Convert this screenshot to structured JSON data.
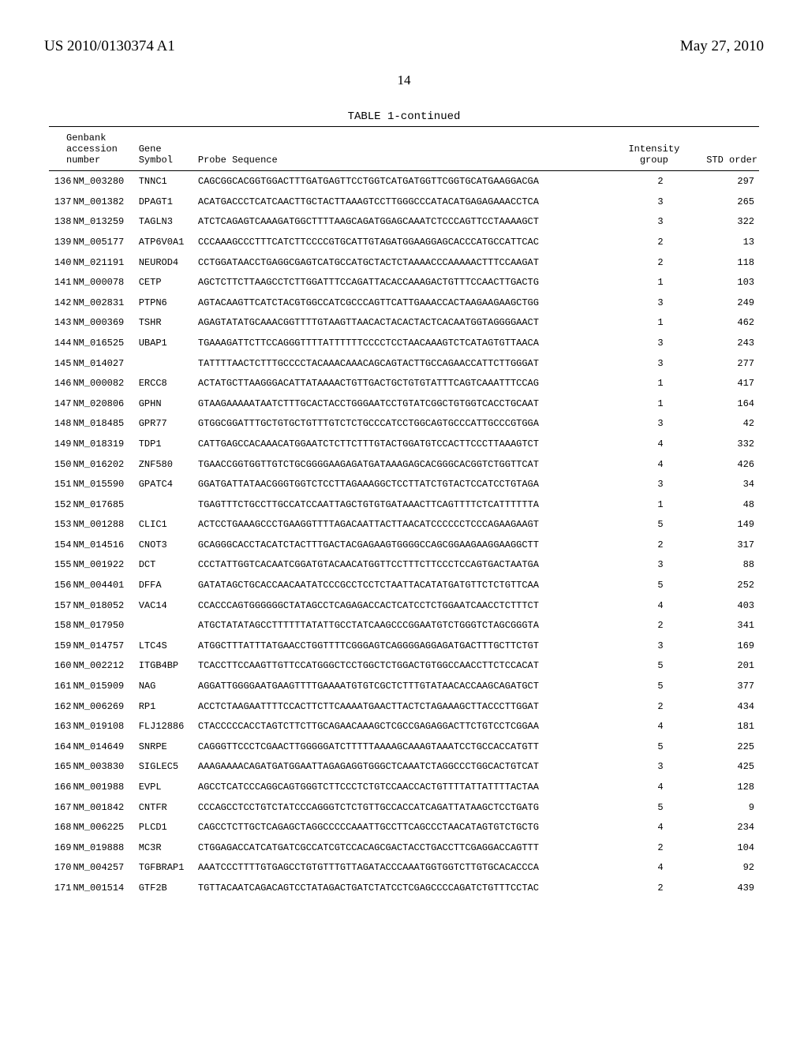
{
  "header": {
    "left": "US 2010/0130374 A1",
    "right": "May 27, 2010"
  },
  "page_number": "14",
  "table": {
    "caption": "TABLE 1-continued",
    "columns": {
      "genbank_l1": "Genbank",
      "genbank_l2": "accession",
      "genbank_l3": "number",
      "gene_l1": "Gene",
      "gene_l2": "Symbol",
      "probe": "Probe Sequence",
      "intensity_l1": "Intensity",
      "intensity_l2": "group",
      "std": "STD order"
    },
    "rows": [
      {
        "idx": "136",
        "acc": "NM_003280",
        "sym": "TNNC1",
        "seq": "CAGCGGCACGGTGGACTTTGATGAGTTCCTGGTCATGATGGTTCGGTGCATGAAGGACGA",
        "grp": "2",
        "std": "297"
      },
      {
        "idx": "137",
        "acc": "NM_001382",
        "sym": "DPAGT1",
        "seq": "ACATGACCCTCATCAACTTGCTACTTAAAGTCCTTGGGCCCATACATGAGAGAAACCTCA",
        "grp": "3",
        "std": "265"
      },
      {
        "idx": "138",
        "acc": "NM_013259",
        "sym": "TAGLN3",
        "seq": "ATCTCAGAGTCAAAGATGGCTTTTAAGCAGATGGAGCAAATCTCCCAGTTCCTAAAAGCT",
        "grp": "3",
        "std": "322"
      },
      {
        "idx": "139",
        "acc": "NM_005177",
        "sym": "ATP6V0A1",
        "seq": "CCCAAAGCCCTTTCATCTTCCCCGTGCATTGTAGATGGAAGGAGCACCCATGCCATTCAC",
        "grp": "2",
        "std": "13"
      },
      {
        "idx": "140",
        "acc": "NM_021191",
        "sym": "NEUROD4",
        "seq": "CCTGGATAACCTGAGGCGAGTCATGCCATGCTACTCTAAAACCCAAAAACTTTCCAAGAT",
        "grp": "2",
        "std": "118"
      },
      {
        "idx": "141",
        "acc": "NM_000078",
        "sym": "CETP",
        "seq": "AGCTCTTCTTAAGCCTCTTGGATTTCCAGATTACACCAAAGACTGTTTCCAACTTGACTG",
        "grp": "1",
        "std": "103"
      },
      {
        "idx": "142",
        "acc": "NM_002831",
        "sym": "PTPN6",
        "seq": "AGTACAAGTTCATCTACGTGGCCATCGCCCAGTTCATTGAAACCACTAAGAAGAAGCTGG",
        "grp": "3",
        "std": "249"
      },
      {
        "idx": "143",
        "acc": "NM_000369",
        "sym": "TSHR",
        "seq": "AGAGTATATGCAAACGGTTTTGTAAGTTAACACTACACTACTCACAATGGTAGGGGAACT",
        "grp": "1",
        "std": "462"
      },
      {
        "idx": "144",
        "acc": "NM_016525",
        "sym": "UBAP1",
        "seq": "TGAAAGATTCTTCCAGGGTTTTATTTTTTCCCCTCCTAACAAAGTCTCATAGTGTTAACA",
        "grp": "3",
        "std": "243"
      },
      {
        "idx": "145",
        "acc": "NM_014027",
        "sym": "",
        "seq": "TATTTTAACTCTTTGCCCCTACAAACAAACAGCAGTACTTGCCAGAACCATTCTTGGGAT",
        "grp": "3",
        "std": "277"
      },
      {
        "idx": "146",
        "acc": "NM_000082",
        "sym": "ERCC8",
        "seq": "ACTATGCTTAAGGGACATTATAAAACTGTTGACTGCTGTGTATTTCAGTCAAATTTCCAG",
        "grp": "1",
        "std": "417"
      },
      {
        "idx": "147",
        "acc": "NM_020806",
        "sym": "GPHN",
        "seq": "GTAAGAAAAATAATCTTTGCACTACCTGGGAATCCTGTATCGGCTGTGGTCACCTGCAAT",
        "grp": "1",
        "std": "164"
      },
      {
        "idx": "148",
        "acc": "NM_018485",
        "sym": "GPR77",
        "seq": "GTGGCGGATTTGCTGTGCTGTTTGTCTCTGCCCATCCTGGCAGTGCCCATTGCCCGTGGA",
        "grp": "3",
        "std": "42"
      },
      {
        "idx": "149",
        "acc": "NM_018319",
        "sym": "TDP1",
        "seq": "CATTGAGCCACAAACATGGAATCTCTTCTTTGTACTGGATGTCCACTTCCCTTAAAGTCT",
        "grp": "4",
        "std": "332"
      },
      {
        "idx": "150",
        "acc": "NM_016202",
        "sym": "ZNF580",
        "seq": "TGAACCGGTGGTTGTCTGCGGGGAAGAGATGATAAAGAGCACGGGCACGGTCTGGTTCAT",
        "grp": "4",
        "std": "426"
      },
      {
        "idx": "151",
        "acc": "NM_015590",
        "sym": "GPATC4",
        "seq": "GGATGATTATAACGGGTGGTCTCCTTAGAAAGGCTCCTTATCTGTACTCCATCCTGTAGA",
        "grp": "3",
        "std": "34"
      },
      {
        "idx": "152",
        "acc": "NM_017685",
        "sym": "",
        "seq": "TGAGTTTCTGCCTTGCCATCCAATTAGCTGTGTGATAAACTTCAGTTTTCTCATTTTTTA",
        "grp": "1",
        "std": "48"
      },
      {
        "idx": "153",
        "acc": "NM_001288",
        "sym": "CLIC1",
        "seq": "ACTCCTGAAAGCCCTGAAGGTTTTAGACAATTACTTAACATCCCCCCTCCCAGAAGAAGT",
        "grp": "5",
        "std": "149"
      },
      {
        "idx": "154",
        "acc": "NM_014516",
        "sym": "CNOT3",
        "seq": "GCAGGGCACCTACATCTACTTTGACTACGAGAAGTGGGGCCAGCGGAAGAAGGAAGGCTT",
        "grp": "2",
        "std": "317"
      },
      {
        "idx": "155",
        "acc": "NM_001922",
        "sym": "DCT",
        "seq": "CCCTATTGGTCACAATCGGATGTACAACATGGTTCCTTTCTTCCCTCCAGTGACTAATGA",
        "grp": "3",
        "std": "88"
      },
      {
        "idx": "156",
        "acc": "NM_004401",
        "sym": "DFFA",
        "seq": "GATATAGCTGCACCAACAATATCCCGCCTCCTCTAATTACATATGATGTTCTCTGTTCAA",
        "grp": "5",
        "std": "252"
      },
      {
        "idx": "157",
        "acc": "NM_018052",
        "sym": "VAC14",
        "seq": "CCACCCAGTGGGGGGCTATAGCCTCAGAGACCACTCATCCTCTGGAATCAACCTCTTTCT",
        "grp": "4",
        "std": "403"
      },
      {
        "idx": "158",
        "acc": "NM_017950",
        "sym": "",
        "seq": "ATGCTATATAGCCTTTTTTATATTGCCTATCAAGCCCGGAATGTCTGGGTCTAGCGGGTA",
        "grp": "2",
        "std": "341"
      },
      {
        "idx": "159",
        "acc": "NM_014757",
        "sym": "LTC4S",
        "seq": "ATGGCTTTATTTATGAACCTGGTTTTCGGGAGTCAGGGGAGGAGATGACTTTGCTTCTGT",
        "grp": "3",
        "std": "169"
      },
      {
        "idx": "160",
        "acc": "NM_002212",
        "sym": "ITGB4BP",
        "seq": "TCACCTTCCAAGTTGTTCCATGGGCTCCTGGCTCTGGACTGTGGCCAACCTTCTCCACAT",
        "grp": "5",
        "std": "201"
      },
      {
        "idx": "161",
        "acc": "NM_015909",
        "sym": "NAG",
        "seq": "AGGATTGGGGAATGAAGTTTTGAAAATGTGTCGCTCTTTGTATAACACCAAGCAGATGCT",
        "grp": "5",
        "std": "377"
      },
      {
        "idx": "162",
        "acc": "NM_006269",
        "sym": "RP1",
        "seq": "ACCTCTAAGAATTTTCCACTTCTTCAAAATGAACTTACTCTAGAAAGCTTACCCTTGGAT",
        "grp": "2",
        "std": "434"
      },
      {
        "idx": "163",
        "acc": "NM_019108",
        "sym": "FLJ12886",
        "seq": "CTACCCCCACCTAGTCTTCTTGCAGAACAAAGCTCGCCGAGAGGACTTCTGTCCTCGGAA",
        "grp": "4",
        "std": "181"
      },
      {
        "idx": "164",
        "acc": "NM_014649",
        "sym": "SNRPE",
        "seq": "CAGGGTTCCCTCGAACTTGGGGGATCTTTTTAAAAGCAAAGTAAATCCTGCCACCATGTT",
        "grp": "5",
        "std": "225"
      },
      {
        "idx": "165",
        "acc": "NM_003830",
        "sym": "SIGLEC5",
        "seq": "AAAGAAAACAGATGATGGAATTAGAGAGGTGGGCTCAAATCTAGGCCCTGGCACTGTCAT",
        "grp": "3",
        "std": "425"
      },
      {
        "idx": "166",
        "acc": "NM_001988",
        "sym": "EVPL",
        "seq": "AGCCTCATCCCAGGCAGTGGGTCTTCCCTCTGTCCAACCACTGTTTTATTATTTTACTAA",
        "grp": "4",
        "std": "128"
      },
      {
        "idx": "167",
        "acc": "NM_001842",
        "sym": "CNTFR",
        "seq": "CCCAGCCTCCTGTCTATCCCAGGGTCTCTGTTGCCACCATCAGATTATAAGCTCCTGATG",
        "grp": "5",
        "std": "9"
      },
      {
        "idx": "168",
        "acc": "NM_006225",
        "sym": "PLCD1",
        "seq": "CAGCCTCTTGCTCAGAGCTAGGCCCCCAAATTGCCTTCAGCCCTAACATAGTGTCTGCTG",
        "grp": "4",
        "std": "234"
      },
      {
        "idx": "169",
        "acc": "NM_019888",
        "sym": "MC3R",
        "seq": "CTGGAGACCATCATGATCGCCATCGTCCACAGCGACTACCTGACCTTCGAGGACCAGTTT",
        "grp": "2",
        "std": "104"
      },
      {
        "idx": "170",
        "acc": "NM_004257",
        "sym": "TGFBRAP1",
        "seq": "AAATCCCTTTTGTGAGCCTGTGTTTGTTAGATACCCAAATGGTGGTCTTGTGCACACCCA",
        "grp": "4",
        "std": "92"
      },
      {
        "idx": "171",
        "acc": "NM_001514",
        "sym": "GTF2B",
        "seq": "TGTTACAATCAGACAGTCCTATAGACTGATCTATCCTCGAGCCCCAGATCTGTTTCCTAC",
        "grp": "2",
        "std": "439"
      }
    ]
  }
}
